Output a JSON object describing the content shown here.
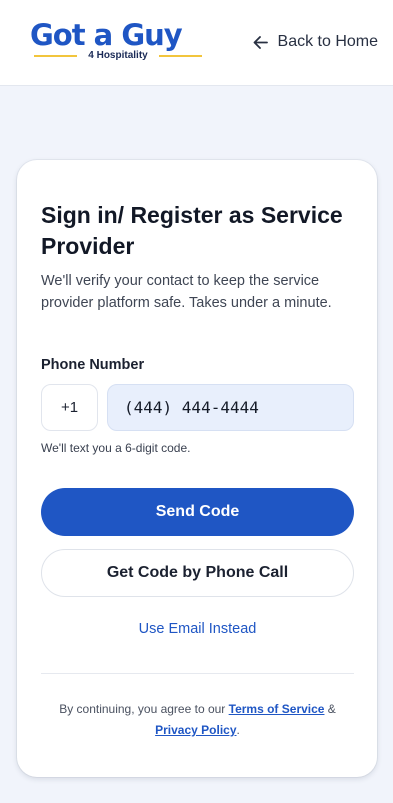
{
  "header": {
    "logo_text": "Got a Guy",
    "logo_subtext": "4 Hospitality",
    "back_label": "Back to Home"
  },
  "card": {
    "title": "Sign in/ Register as Service Provider",
    "description": "We'll verify your contact to keep the service provider platform safe. Takes under a minute.",
    "phone_label": "Phone Number",
    "country_code": "+1",
    "phone_value": "(444) 444-4444",
    "hint": "We'll text you a 6-digit code.",
    "send_button": "Send Code",
    "call_button": "Get Code by Phone Call",
    "email_link": "Use Email Instead",
    "legal": {
      "prefix": "By continuing, you agree to our ",
      "terms": "Terms of Service",
      "and": " & ",
      "privacy": "Privacy Policy",
      "suffix": "."
    }
  },
  "colors": {
    "brand_blue": "#1f56c4",
    "logo_accent": "#f2c53c",
    "page_bg": "#f1f4fb",
    "input_bg": "#e8effc"
  },
  "icons": {
    "back": "arrow-left-icon"
  }
}
